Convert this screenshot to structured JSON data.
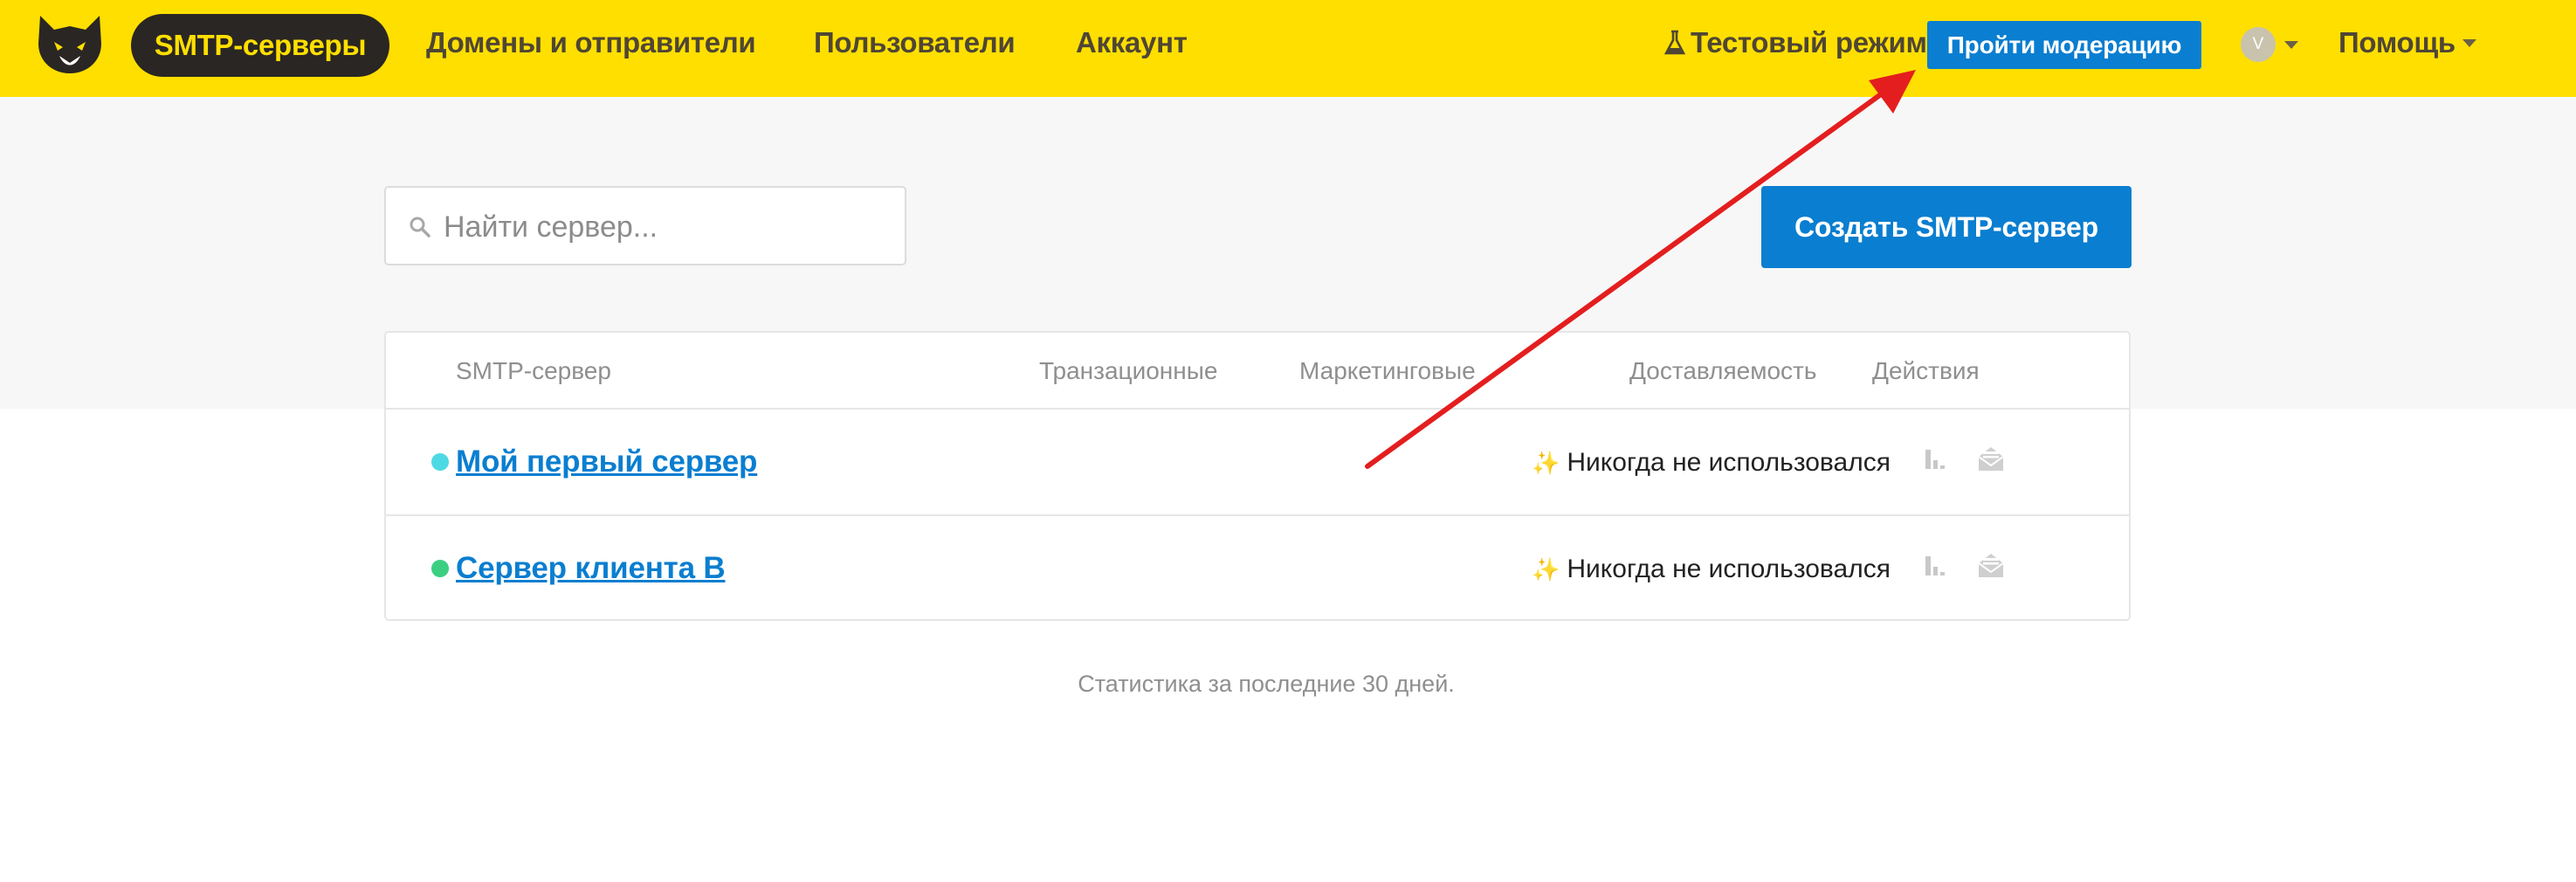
{
  "topbar": {
    "logo_icon": "husky-logo-icon",
    "nav_active": "SMTP-серверы",
    "nav": [
      "Домены и отправители",
      "Пользователи",
      "Аккаунт"
    ],
    "test_mode_icon": "flask-icon",
    "test_mode": "Тестовый режим",
    "moderation_button": "Пройти модерацию",
    "avatar_letter": "V",
    "help": "Помощь"
  },
  "toolbar": {
    "search_placeholder": "Найти сервер...",
    "search_value": "",
    "create_button": "Создать SMTP-сервер"
  },
  "table": {
    "columns": [
      "SMTP-сервер",
      "Транзационные",
      "Маркетинговые",
      "Доставляемость",
      "Действия"
    ],
    "rows": [
      {
        "name": "Мой первый сервер",
        "status_color": "#4dd9e4",
        "deliverability": "Никогда не использовался",
        "deliverability_icon": "sparkles-icon",
        "actions": [
          "stats-icon",
          "mail-icon"
        ]
      },
      {
        "name": "Сервер клиента В",
        "status_color": "#3ccf82",
        "deliverability": "Никогда не использовался",
        "deliverability_icon": "sparkles-icon",
        "actions": [
          "stats-icon",
          "mail-icon"
        ]
      }
    ]
  },
  "footnote": "Статистика за последние 30 дней.",
  "colors": {
    "brand_yellow": "#ffdf00",
    "primary_blue": "#0a7ed0",
    "annotation_arrow": "#e41e1e"
  }
}
